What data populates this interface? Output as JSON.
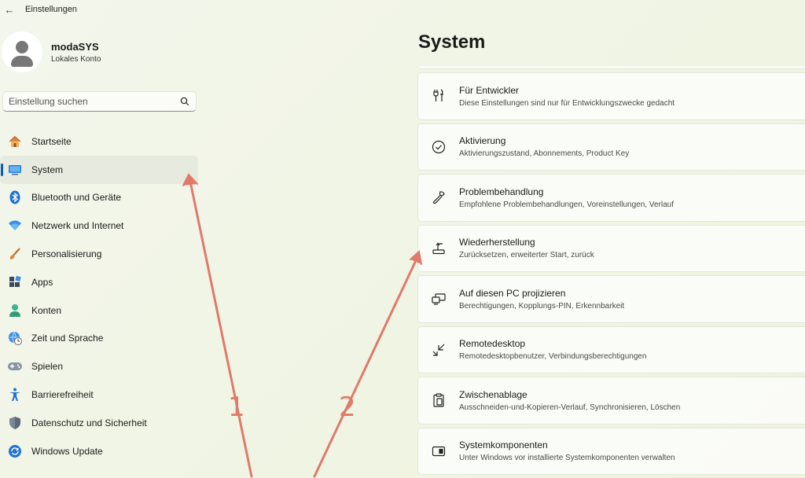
{
  "window": {
    "title": "Einstellungen",
    "back_symbol": "←"
  },
  "profile": {
    "name": "modaSYS",
    "account_type": "Lokales Konto"
  },
  "search": {
    "placeholder": "Einstellung suchen"
  },
  "sidebar": {
    "active_index": 1,
    "items": [
      {
        "label": "Startseite",
        "icon": "home-icon"
      },
      {
        "label": "System",
        "icon": "system-icon"
      },
      {
        "label": "Bluetooth und Geräte",
        "icon": "bluetooth-icon"
      },
      {
        "label": "Netzwerk und Internet",
        "icon": "wifi-icon"
      },
      {
        "label": "Personalisierung",
        "icon": "brush-icon"
      },
      {
        "label": "Apps",
        "icon": "apps-icon"
      },
      {
        "label": "Konten",
        "icon": "account-icon"
      },
      {
        "label": "Zeit und Sprache",
        "icon": "globe-clock-icon"
      },
      {
        "label": "Spielen",
        "icon": "gamepad-icon"
      },
      {
        "label": "Barrierefreiheit",
        "icon": "accessibility-icon"
      },
      {
        "label": "Datenschutz und Sicherheit",
        "icon": "shield-icon"
      },
      {
        "label": "Windows Update",
        "icon": "update-icon"
      }
    ]
  },
  "main": {
    "title": "System",
    "settings": [
      {
        "title": "Für Entwickler",
        "desc": "Diese Einstellungen sind nur für Entwicklungszwecke gedacht",
        "icon": "developer-tools-icon"
      },
      {
        "title": "Aktivierung",
        "desc": "Aktivierungszustand, Abonnements, Product Key",
        "icon": "check-circle-icon"
      },
      {
        "title": "Problembehandlung",
        "desc": "Empfohlene Problembehandlungen, Voreinstellungen, Verlauf",
        "icon": "wrench-icon"
      },
      {
        "title": "Wiederherstellung",
        "desc": "Zurücksetzen, erweiterter Start, zurück",
        "icon": "recovery-icon"
      },
      {
        "title": "Auf diesen PC projizieren",
        "desc": "Berechtigungen, Kopplungs-PIN, Erkennbarkeit",
        "icon": "project-icon"
      },
      {
        "title": "Remotedesktop",
        "desc": "Remotedesktopbenutzer, Verbindungsberechtigungen",
        "icon": "remote-desktop-icon"
      },
      {
        "title": "Zwischenablage",
        "desc": "Ausschneiden-und-Kopieren-Verlauf, Synchronisieren, Löschen",
        "icon": "clipboard-icon"
      },
      {
        "title": "Systemkomponenten",
        "desc": "Unter Windows vor installierte Systemkomponenten verwalten",
        "icon": "components-icon"
      }
    ]
  },
  "annotations": {
    "color": "#e07a6a",
    "labels": [
      "1",
      "2"
    ]
  },
  "colors": {
    "accent": "#005fb8"
  }
}
